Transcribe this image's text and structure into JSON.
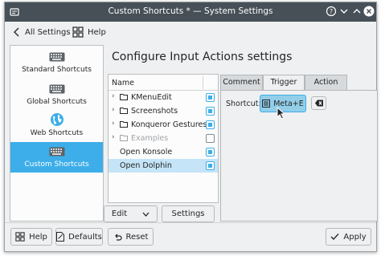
{
  "window": {
    "title": "Custom Shortcuts * — System Settings",
    "controls": [
      "help-icon",
      "minimize-icon",
      "maximize-icon",
      "close-icon"
    ]
  },
  "toolbar": {
    "back_label": "All Settings",
    "help_label": "Help"
  },
  "sidebar": {
    "items": [
      {
        "label": "Standard Shortcuts",
        "icon": "keyboard-icon",
        "active": false
      },
      {
        "label": "Global Shortcuts",
        "icon": "keyboard-icon",
        "active": false
      },
      {
        "label": "Web Shortcuts",
        "icon": "globe-icon",
        "active": false
      },
      {
        "label": "Custom Shortcuts",
        "icon": "keyboard-icon",
        "active": true
      }
    ]
  },
  "main": {
    "heading": "Configure Input Actions settings",
    "tree": {
      "column_header": "Name",
      "rows": [
        {
          "label": "KMenuEdit",
          "type": "folder",
          "checked": true,
          "enabled": true,
          "selected": false
        },
        {
          "label": "Screenshots",
          "type": "folder",
          "checked": true,
          "enabled": true,
          "selected": false
        },
        {
          "label": "Konqueror Gestures",
          "type": "folder",
          "checked": true,
          "enabled": true,
          "selected": false
        },
        {
          "label": "Examples",
          "type": "folder",
          "checked": false,
          "enabled": false,
          "selected": false
        },
        {
          "label": "Open Konsole",
          "type": "action",
          "checked": true,
          "enabled": true,
          "selected": false
        },
        {
          "label": "Open Dolphin",
          "type": "action",
          "checked": true,
          "enabled": true,
          "selected": true
        }
      ]
    },
    "edit_button_label": "Edit",
    "settings_button_label": "Settings",
    "tabs": [
      {
        "label": "Comment",
        "active": false
      },
      {
        "label": "Trigger",
        "active": true
      },
      {
        "label": "Action",
        "active": false
      }
    ],
    "trigger": {
      "shortcut_label": "Shortcut:",
      "shortcut_value": "Meta+E"
    }
  },
  "footer": {
    "help_label": "Help",
    "defaults_label": "Defaults",
    "reset_label": "Reset",
    "apply_label": "Apply"
  },
  "colors": {
    "accent": "#3daee9",
    "titlebar": "#475057",
    "selection": "#c5e4f7"
  }
}
